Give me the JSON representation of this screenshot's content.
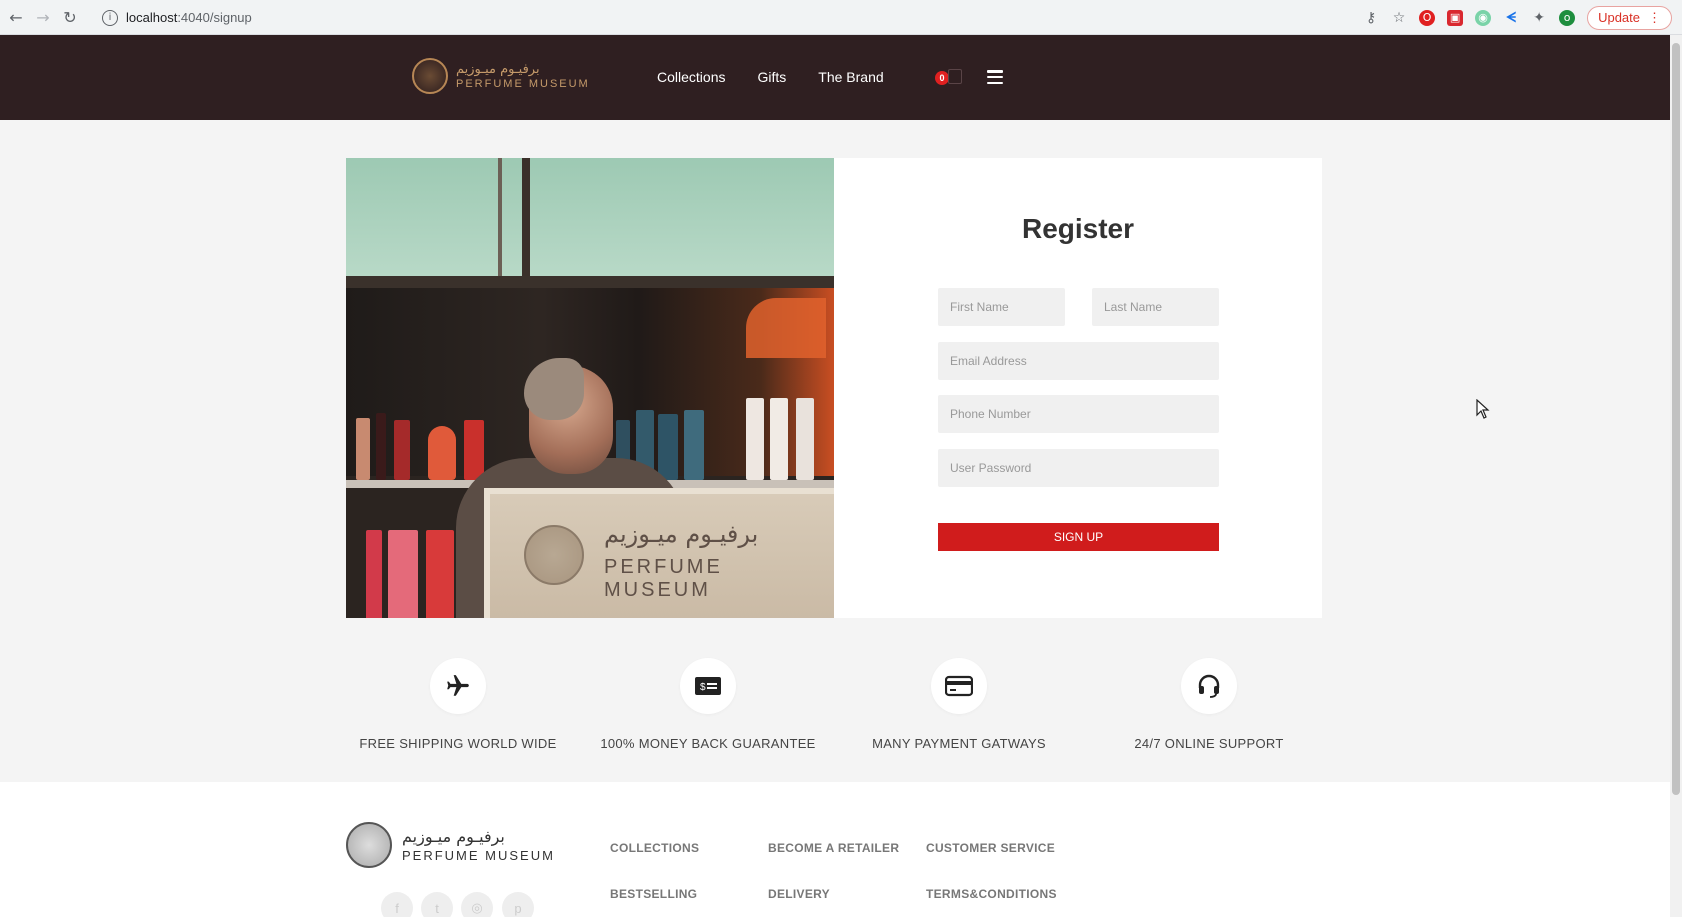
{
  "browser": {
    "url_host": "localhost",
    "url_path": ":4040/signup",
    "update_label": "Update",
    "profile_initial": "o"
  },
  "header": {
    "logo_arabic": "برفيـوم ميـوزيم",
    "logo_english": "PERFUME MUSEUM",
    "nav": [
      "Collections",
      "Gifts",
      "The Brand"
    ],
    "cart_count": "0"
  },
  "hero_image": {
    "sign_arabic": "برفيـوم ميـوزيم",
    "sign_english": "PERFUME MUSEUM"
  },
  "register": {
    "title": "Register",
    "first_name_placeholder": "First Name",
    "last_name_placeholder": "Last Name",
    "email_placeholder": "Email Address",
    "phone_placeholder": "Phone Number",
    "password_placeholder": "User Password",
    "submit_label": "SIGN UP"
  },
  "features": [
    {
      "label": "FREE SHIPPING WORLD WIDE",
      "icon": "airplane-icon"
    },
    {
      "label": "100% MONEY BACK GUARANTEE",
      "icon": "money-icon"
    },
    {
      "label": "MANY PAYMENT GATWAYS",
      "icon": "credit-card-icon"
    },
    {
      "label": "24/7 ONLINE SUPPORT",
      "icon": "headset-icon"
    }
  ],
  "footer": {
    "logo_arabic": "برفيـوم ميـوزيم",
    "logo_english": "PERFUME MUSEUM",
    "links": [
      "COLLECTIONS",
      "BECOME A RETAILER",
      "CUSTOMER SERVICE",
      "BESTSELLING",
      "DELIVERY",
      "TERMS&CONDITIONS"
    ],
    "social": [
      "facebook-icon",
      "twitter-icon",
      "instagram-icon",
      "pinterest-icon"
    ]
  },
  "colors": {
    "header_bg": "#2f1f21",
    "accent_red": "#d01c1c",
    "logo_gold": "#c59a6a"
  }
}
